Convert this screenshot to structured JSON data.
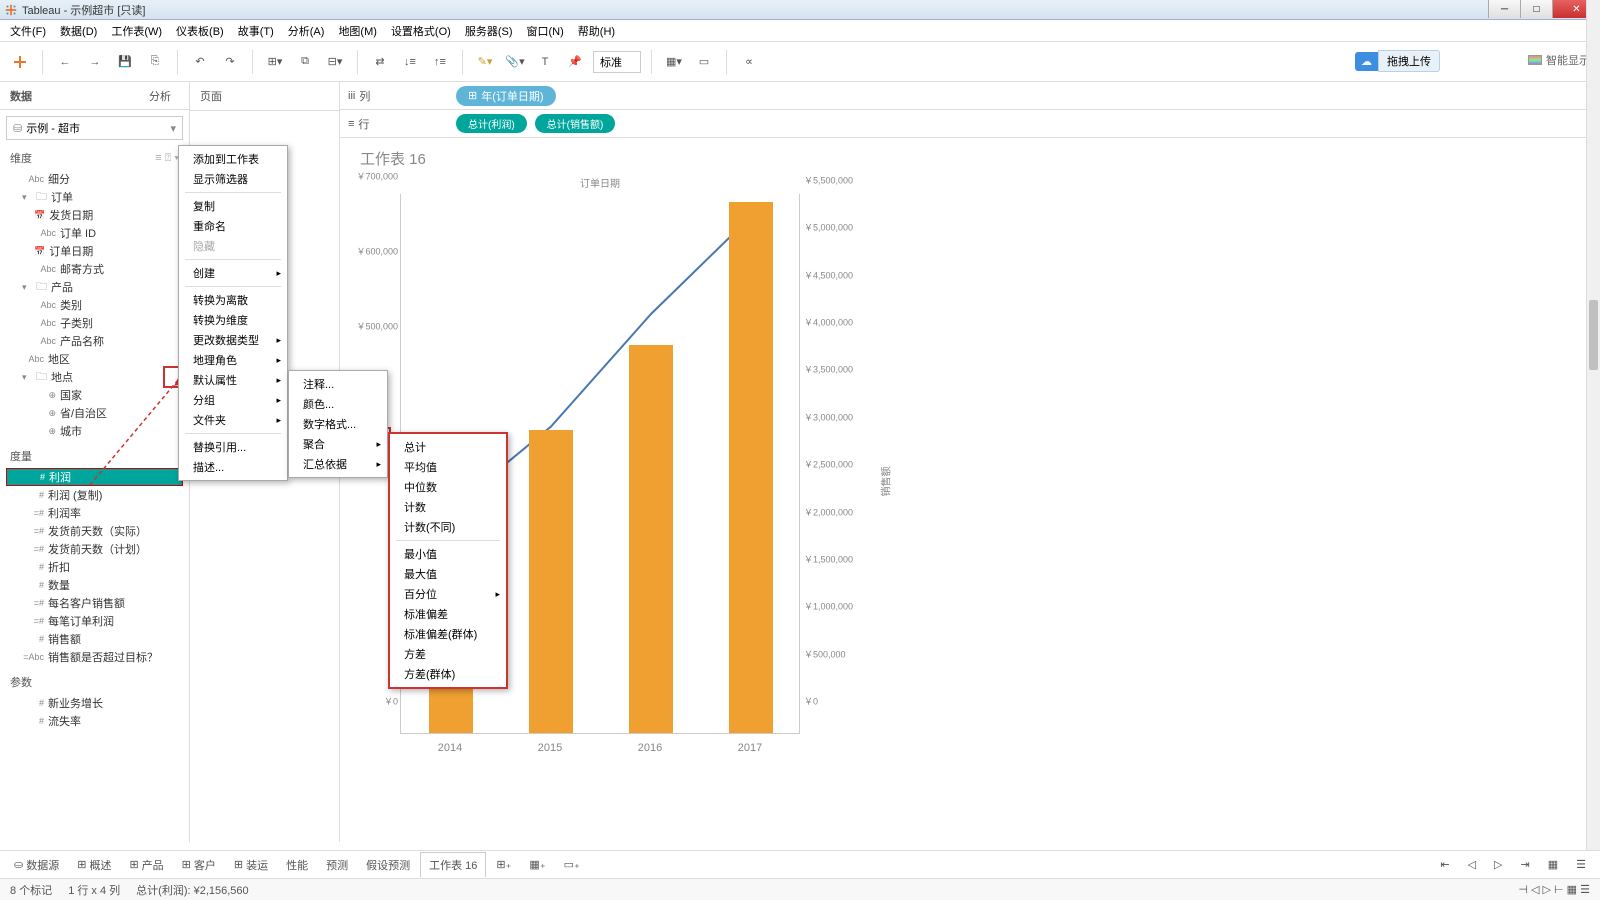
{
  "window": {
    "title": "Tableau - 示例超市 [只读]"
  },
  "menubar": [
    "文件(F)",
    "数据(D)",
    "工作表(W)",
    "仪表板(B)",
    "故事(T)",
    "分析(A)",
    "地图(M)",
    "设置格式(O)",
    "服务器(S)",
    "窗口(N)",
    "帮助(H)"
  ],
  "toolbar": {
    "std": "标准",
    "upload_btn": "拖拽上传",
    "smart": "智能显示"
  },
  "left": {
    "tabs": [
      "数据",
      "分析"
    ],
    "datasource": "示例 - 超市",
    "dim_header": "维度",
    "dims": [
      {
        "t": "Abc",
        "n": "细分",
        "lv": 0
      },
      {
        "cv": "v",
        "t": "",
        "n": "订单",
        "lv": 0,
        "folder": true
      },
      {
        "t": "",
        "n": "发货日期",
        "lv": 1,
        "cal": true
      },
      {
        "t": "Abc",
        "n": "订单 ID",
        "lv": 1
      },
      {
        "t": "",
        "n": "订单日期",
        "lv": 1,
        "cal": true
      },
      {
        "t": "Abc",
        "n": "邮寄方式",
        "lv": 1
      },
      {
        "cv": "v",
        "t": "",
        "n": "产品",
        "lv": 0,
        "folder": true
      },
      {
        "t": "Abc",
        "n": "类别",
        "lv": 1
      },
      {
        "t": "Abc",
        "n": "子类别",
        "lv": 1
      },
      {
        "t": "Abc",
        "n": "产品名称",
        "lv": 1
      },
      {
        "t": "Abc",
        "n": "地区",
        "lv": 0
      },
      {
        "cv": "v",
        "t": "",
        "n": "地点",
        "lv": 0,
        "folder": true
      },
      {
        "t": "⊕",
        "n": "国家",
        "lv": 1
      },
      {
        "t": "⊕",
        "n": "省/自治区",
        "lv": 1
      },
      {
        "t": "⊕",
        "n": "城市",
        "lv": 1
      }
    ],
    "meas_header": "度量",
    "meas": [
      {
        "t": "#",
        "n": "利润",
        "sel": true
      },
      {
        "t": "#",
        "n": "利润 (复制)"
      },
      {
        "t": "=#",
        "n": "利润率"
      },
      {
        "t": "=#",
        "n": "发货前天数（实际）"
      },
      {
        "t": "=#",
        "n": "发货前天数（计划）"
      },
      {
        "t": "#",
        "n": "折扣"
      },
      {
        "t": "#",
        "n": "数量"
      },
      {
        "t": "=#",
        "n": "每名客户销售额"
      },
      {
        "t": "=#",
        "n": "每笔订单利润"
      },
      {
        "t": "#",
        "n": "销售额"
      },
      {
        "t": "=Abc",
        "n": "销售额是否超过目标？"
      }
    ],
    "param_header": "参数",
    "params": [
      {
        "t": "#",
        "n": "新业务增长"
      },
      {
        "t": "#",
        "n": "流失率"
      }
    ]
  },
  "mid": {
    "pages": "页面"
  },
  "shelves": {
    "col_label": "列",
    "col_pill": "年(订单日期)",
    "row_label": "行",
    "row_pills": [
      "总计(利润)",
      "总计(销售额)"
    ]
  },
  "chart": {
    "title": "工作表 16",
    "sub": "订单日期",
    "right_axis_label": "销售额"
  },
  "context1": {
    "items": [
      {
        "l": "添加到工作表"
      },
      {
        "l": "显示筛选器"
      },
      {
        "sep": true
      },
      {
        "l": "复制"
      },
      {
        "l": "重命名"
      },
      {
        "l": "隐藏",
        "dis": true
      },
      {
        "sep": true
      },
      {
        "l": "创建",
        "sub": true
      },
      {
        "sep": true
      },
      {
        "l": "转换为离散"
      },
      {
        "l": "转换为维度"
      },
      {
        "l": "更改数据类型",
        "sub": true
      },
      {
        "l": "地理角色",
        "sub": true
      },
      {
        "l": "默认属性",
        "sub": true,
        "hl": true
      },
      {
        "l": "分组",
        "sub": true
      },
      {
        "l": "文件夹",
        "sub": true
      },
      {
        "sep": true
      },
      {
        "l": "替换引用..."
      },
      {
        "l": "描述..."
      }
    ]
  },
  "context2": {
    "items": [
      {
        "l": "注释..."
      },
      {
        "l": "颜色..."
      },
      {
        "l": "数字格式..."
      },
      {
        "l": "聚合",
        "sub": true,
        "hl": true
      },
      {
        "l": "汇总依据",
        "sub": true
      }
    ]
  },
  "context3": {
    "items": [
      {
        "l": "总计"
      },
      {
        "l": "平均值"
      },
      {
        "l": "中位数"
      },
      {
        "l": "计数"
      },
      {
        "l": "计数(不同)"
      },
      {
        "sep": true
      },
      {
        "l": "最小值"
      },
      {
        "l": "最大值"
      },
      {
        "l": "百分位",
        "sub": true
      },
      {
        "l": "标准偏差"
      },
      {
        "l": "标准偏差(群体)"
      },
      {
        "l": "方差"
      },
      {
        "l": "方差(群体)"
      }
    ]
  },
  "bottom_tabs": [
    "数据源",
    "概述",
    "产品",
    "客户",
    "装运",
    "性能",
    "预测",
    "假设预测",
    "工作表 16"
  ],
  "statusbar": {
    "marks": "8 个标记",
    "rc": "1 行 x 4 列",
    "sum": "总计(利润): ¥2,156,560"
  },
  "chart_data": {
    "type": "bar+line",
    "categories": [
      "2014",
      "2015",
      "2016",
      "2017"
    ],
    "bar_series": {
      "name": "销售额",
      "values": [
        2500000,
        3200000,
        4100000,
        5600000
      ],
      "axis": "right"
    },
    "line_series": {
      "name": "利润",
      "values": [
        300000,
        410000,
        560000,
        690000
      ],
      "axis": "left"
    },
    "left_ticks": [
      0,
      500000,
      600000,
      700000
    ],
    "left_ticks_fmt": [
      "￥0",
      "￥500,000",
      "￥600,000",
      "￥700,000"
    ],
    "left_tick_positions": [
      0,
      500000,
      600000,
      700000
    ],
    "right_ticks": [
      0,
      500000,
      1000000,
      1500000,
      2000000,
      2500000,
      3000000,
      3500000,
      4000000,
      4500000,
      5000000,
      5500000
    ],
    "right_ticks_fmt": [
      "￥0",
      "￥500,000",
      "￥1,000,000",
      "￥1,500,000",
      "￥2,000,000",
      "￥2,500,000",
      "￥3,000,000",
      "￥3,500,000",
      "￥4,000,000",
      "￥4,500,000",
      "￥5,000,000",
      "￥5,500,000"
    ],
    "left_max": 720000,
    "right_max": 5700000
  }
}
